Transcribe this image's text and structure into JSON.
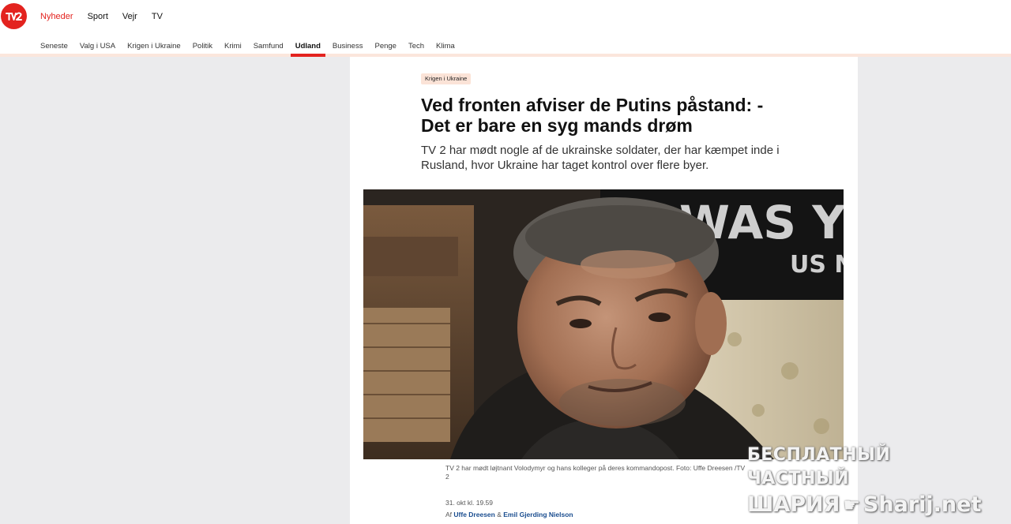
{
  "header": {
    "main_nav": [
      "Nyheder",
      "Sport",
      "Vejr",
      "TV"
    ],
    "main_nav_active": "Nyheder",
    "sub_nav": [
      "Seneste",
      "Valg i USA",
      "Krigen i Ukraine",
      "Politik",
      "Krimi",
      "Samfund",
      "Udland",
      "Business",
      "Penge",
      "Tech",
      "Klima"
    ],
    "sub_nav_active": "Udland"
  },
  "article": {
    "tag": "Krigen i Ukraine",
    "headline": "Ved fronten afviser de Putins påstand: - Det er bare en syg mands drøm",
    "lead": "TV 2 har mødt nogle af de ukrainske soldater, der har kæmpet inde i Rusland, hvor Ukraine har taget kontrol over flere byer.",
    "photo_flag_text": [
      "WAS Y",
      "US N"
    ],
    "caption": "TV 2 har mødt løjtnant Volodymyr og hans kolleger på deres kommandopost. Foto: Uffe Dreesen /TV 2",
    "date": "31. okt kl. 19.59",
    "byline_prefix": "Af",
    "author_1": "Uffe Dreesen",
    "byline_joiner": "&",
    "author_2": "Emil Gjerding Nielson"
  },
  "watermark": {
    "line1": "БЕСПЛАТНЫЙ ЧАСТНЫЙ",
    "line2_left": "ШАРИЯ",
    "line2_right": "Sharij.net"
  },
  "colors": {
    "brand_red": "#e3231f",
    "tag_bg": "#fbe3d7",
    "link_blue": "#1a4d8f",
    "page_bg": "#ebebed"
  }
}
